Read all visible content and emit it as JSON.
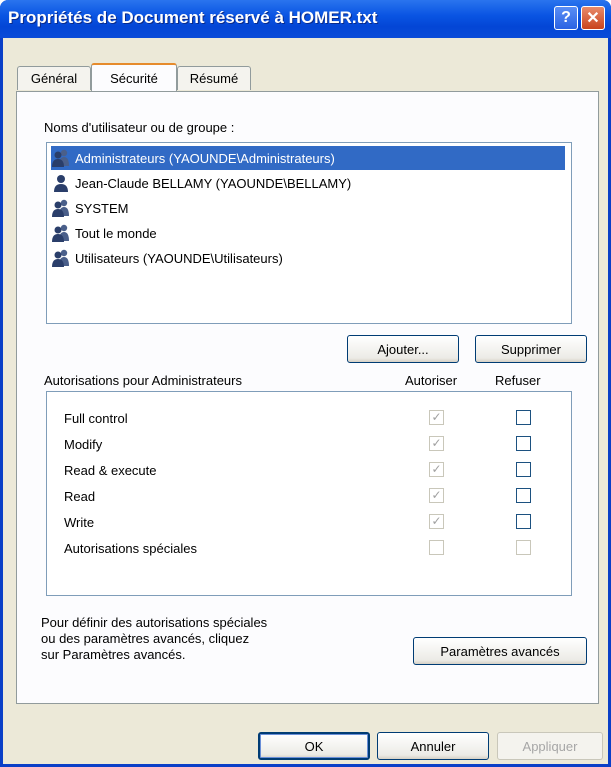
{
  "window": {
    "title": "Propriétés de Document réservé à HOMER.txt",
    "help_label": "?",
    "close_label": "✕"
  },
  "tabs": [
    {
      "label": "Général",
      "active": false
    },
    {
      "label": "Sécurité",
      "active": true
    },
    {
      "label": "Résumé",
      "active": false
    }
  ],
  "users_section": {
    "label": "Noms d'utilisateur ou de groupe :",
    "items": [
      {
        "name": "Administrateurs (YAOUNDE\\Administrateurs)",
        "icon": "group-icon",
        "selected": true
      },
      {
        "name": "Jean-Claude BELLAMY (YAOUNDE\\BELLAMY)",
        "icon": "user-icon",
        "selected": false
      },
      {
        "name": "SYSTEM",
        "icon": "group-icon",
        "selected": false
      },
      {
        "name": "Tout le monde",
        "icon": "group-icon",
        "selected": false
      },
      {
        "name": "Utilisateurs (YAOUNDE\\Utilisateurs)",
        "icon": "group-icon",
        "selected": false
      }
    ],
    "add_label": "Ajouter...",
    "remove_label": "Supprimer"
  },
  "permissions": {
    "header": "Autorisations pour Administrateurs",
    "allow_header": "Autoriser",
    "deny_header": "Refuser",
    "rows": [
      {
        "label": "Full control",
        "allow": true,
        "deny": false
      },
      {
        "label": "Modify",
        "allow": true,
        "deny": false
      },
      {
        "label": "Read & execute",
        "allow": true,
        "deny": false
      },
      {
        "label": "Read",
        "allow": true,
        "deny": false
      },
      {
        "label": "Write",
        "allow": true,
        "deny": false
      },
      {
        "label": "Autorisations spéciales",
        "allow": false,
        "deny": false
      }
    ]
  },
  "advanced": {
    "info_lines": [
      "Pour définir des autorisations spéciales",
      "ou des paramètres avancés, cliquez",
      "sur Paramètres avancés."
    ],
    "button_label": "Paramètres avancés"
  },
  "footer": {
    "ok_label": "OK",
    "cancel_label": "Annuler",
    "apply_label": "Appliquer"
  },
  "colors": {
    "titlebar": "#0a55e3",
    "selection": "#316ac5",
    "dialog_bg": "#ece9d8",
    "active_tab_accent": "#e68b2c"
  }
}
